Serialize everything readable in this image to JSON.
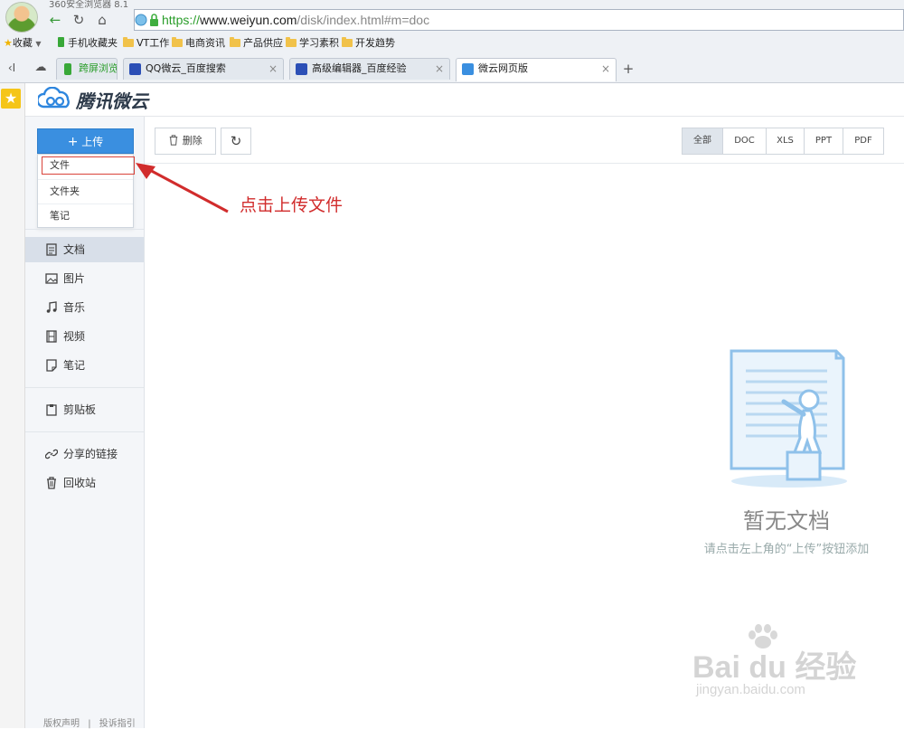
{
  "browser": {
    "title": "360安全浏览器 8.1",
    "address": {
      "scheme": "https://",
      "domain": "www.weiyun.com",
      "path": "/disk/index.html#m=doc"
    },
    "bookmarks": [
      {
        "label": "收藏"
      },
      {
        "label": "手机收藏夹"
      },
      {
        "label": "VT工作"
      },
      {
        "label": "电商资讯"
      },
      {
        "label": "产品供应"
      },
      {
        "label": "学习素积"
      },
      {
        "label": "开发趋势"
      }
    ],
    "tabs": [
      {
        "label": "跨屏浏览"
      },
      {
        "label": "QQ微云_百度搜索"
      },
      {
        "label": "高级编辑器_百度经验"
      },
      {
        "label": "微云网页版"
      }
    ]
  },
  "app": {
    "logo_text": "腾讯微云",
    "upload": {
      "label": "上传",
      "menu": [
        "文件",
        "文件夹",
        "笔记"
      ]
    },
    "nav": [
      {
        "label": "文档",
        "icon": "document-icon",
        "active": true
      },
      {
        "label": "图片",
        "icon": "image-icon"
      },
      {
        "label": "音乐",
        "icon": "music-icon"
      },
      {
        "label": "视频",
        "icon": "video-icon"
      },
      {
        "label": "笔记",
        "icon": "note-icon"
      }
    ],
    "clipboard": "剪贴板",
    "shared_links": "分享的链接",
    "recycle_bin": "回收站",
    "footer": {
      "copyright": "版权声明",
      "separator": "|",
      "complaint": "投诉指引"
    },
    "toolbar": {
      "delete_label": "删除",
      "filters": [
        "全部",
        "DOC",
        "XLS",
        "PPT",
        "PDF"
      ],
      "active_filter": "全部"
    },
    "empty_state": {
      "title": "暂无文档",
      "hint": "请点击左上角的“上传”按钮添加"
    }
  },
  "annotation": {
    "text": "点击上传文件",
    "color": "#d12c2c"
  },
  "watermark": {
    "main": "Bai  du 经验",
    "sub": "jingyan.baidu.com"
  },
  "colors": {
    "accent": "#3a8fe0",
    "highlight": "#d9433a",
    "sidebar_active": "#d8dfe9"
  }
}
